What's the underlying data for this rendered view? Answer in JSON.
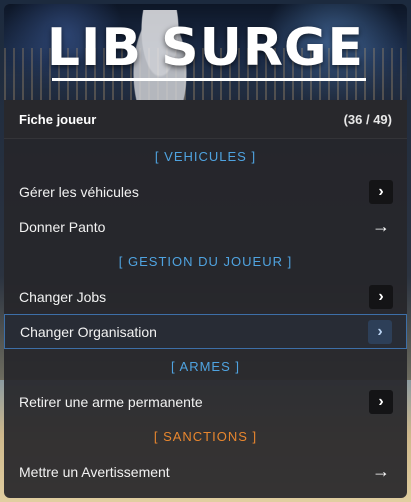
{
  "banner": {
    "logo_text": "LIB SURGE"
  },
  "header": {
    "title": "Fiche joueur",
    "count": "(36 / 49)"
  },
  "colors": {
    "section_blue": "#4fa3e0",
    "section_orange": "#e8862e",
    "selected_border": "#3d6fa8"
  },
  "menu": {
    "sections": [
      {
        "label": "[ VEHICULES ]",
        "color": "#4fa3e0",
        "items": [
          {
            "label": "Gérer les véhicules",
            "icon": "chevron-right-icon"
          },
          {
            "label": "Donner Panto",
            "icon": "arrow-right-icon"
          }
        ]
      },
      {
        "label": "[ GESTION DU JOUEUR ]",
        "color": "#4fa3e0",
        "items": [
          {
            "label": "Changer Jobs",
            "icon": "chevron-right-icon"
          },
          {
            "label": "Changer Organisation",
            "icon": "chevron-right-icon",
            "selected": true
          }
        ]
      },
      {
        "label": "[ ARMES ]",
        "color": "#4fa3e0",
        "items": [
          {
            "label": "Retirer une arme permanente",
            "icon": "chevron-right-icon"
          }
        ]
      },
      {
        "label": "[ SANCTIONS ]",
        "color": "#e8862e",
        "items": [
          {
            "label": "Mettre un Avertissement",
            "icon": "arrow-right-icon"
          }
        ]
      }
    ]
  },
  "icons": {
    "chevron": "›",
    "arrow": "→"
  }
}
